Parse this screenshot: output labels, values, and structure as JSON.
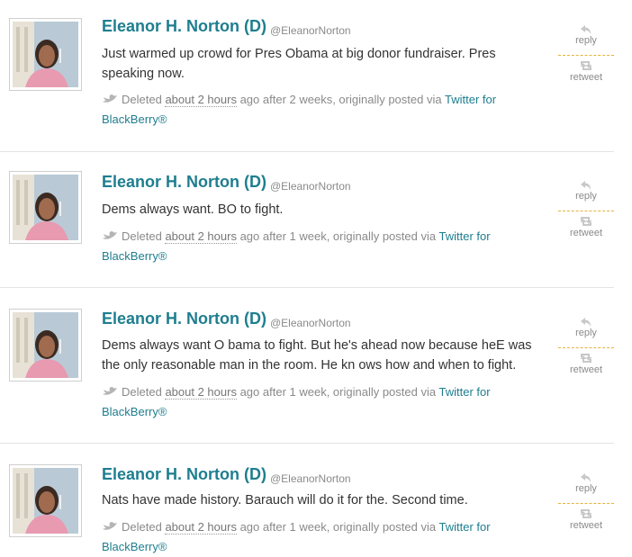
{
  "tweets": [
    {
      "name": "Eleanor H. Norton (D)",
      "handle": "@EleanorNorton",
      "text": "Just warmed up crowd for Pres Obama at big donor fundraiser. Pres speaking now.",
      "meta": {
        "deleted": "Deleted",
        "when": "about 2 hours",
        "ago": "ago after 2 weeks, originally posted via",
        "via": "Twitter for BlackBerry®"
      },
      "reply_label": "reply",
      "retweet_label": "retweet"
    },
    {
      "name": "Eleanor H. Norton (D)",
      "handle": "@EleanorNorton",
      "text": "Dems always want. BO to fight.",
      "meta": {
        "deleted": "Deleted",
        "when": "about 2 hours",
        "ago": "ago after 1 week, originally posted via",
        "via": "Twitter for BlackBerry®"
      },
      "reply_label": "reply",
      "retweet_label": "retweet"
    },
    {
      "name": "Eleanor H. Norton (D)",
      "handle": "@EleanorNorton",
      "text": "Dems always want O bama to fight. But he's ahead now because heE was the only reasonable man in the room. He kn ows how and when to fight.",
      "meta": {
        "deleted": "Deleted",
        "when": "about 2 hours",
        "ago": "ago after 1 week, originally posted via",
        "via": "Twitter for BlackBerry®"
      },
      "reply_label": "reply",
      "retweet_label": "retweet"
    },
    {
      "name": "Eleanor H. Norton (D)",
      "handle": "@EleanorNorton",
      "text": "Nats have made history. Barauch will do it for the. Second time.",
      "meta": {
        "deleted": "Deleted",
        "when": "about 2 hours",
        "ago": "ago after 1 week, originally posted via",
        "via": "Twitter for BlackBerry®"
      },
      "reply_label": "reply",
      "retweet_label": "retweet"
    }
  ],
  "colors": {
    "name": "#1e7e8f",
    "link": "#1e7e8f",
    "meta": "#8a8a8a",
    "separator": "#e3b33b"
  },
  "icons": {
    "reply": "reply-arrow-icon",
    "retweet": "retweet-icon",
    "source": "bird-icon"
  }
}
